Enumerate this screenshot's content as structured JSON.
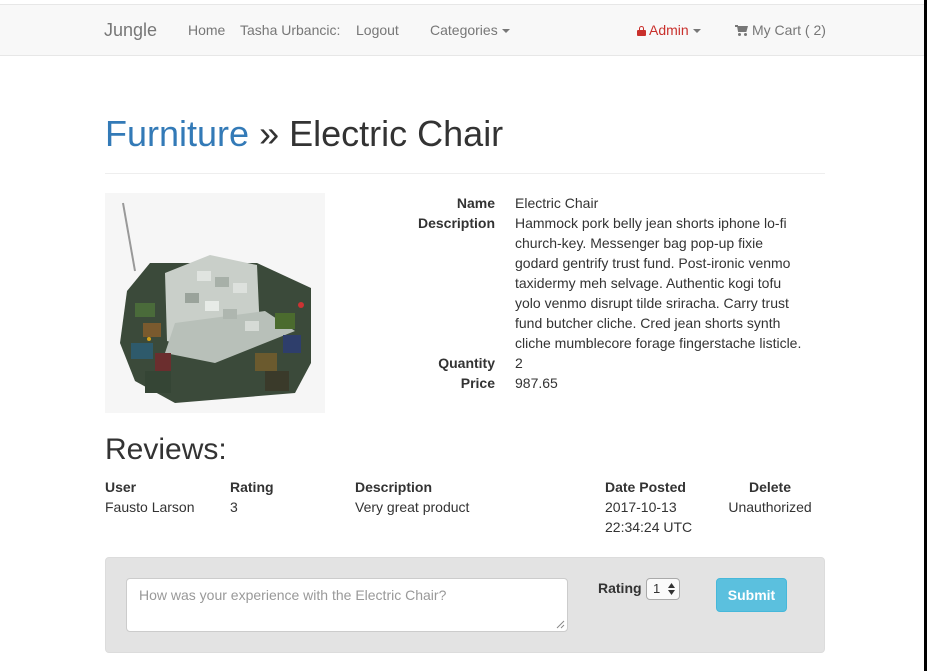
{
  "navbar": {
    "brand": "Jungle",
    "home": "Home",
    "user": "Tasha Urbancic:",
    "logout": "Logout",
    "categories": "Categories",
    "admin": "Admin",
    "cart": "My Cart ( 2)"
  },
  "breadcrumb": {
    "category": "Furniture",
    "separator": "»",
    "product": "Electric Chair"
  },
  "product": {
    "labels": {
      "name": "Name",
      "description": "Description",
      "quantity": "Quantity",
      "price": "Price"
    },
    "name": "Electric Chair",
    "description": "Hammock pork belly jean shorts iphone lo-fi church-key. Messenger bag pop-up fixie godard gentrify trust fund. Post-ironic venmo taxidermy meh selvage. Authentic kogi tofu yolo venmo disrupt tilde sriracha. Carry trust fund butcher cliche. Cred jean shorts synth cliche mumblecore forage fingerstache listicle.",
    "quantity": "2",
    "price": "987.65"
  },
  "reviews": {
    "heading": "Reviews:",
    "columns": [
      "User",
      "Rating",
      "Description",
      "Date Posted",
      "Delete"
    ],
    "rows": [
      {
        "user": "Fausto Larson",
        "rating": "3",
        "description": "Very great product",
        "date_line1": "2017-10-13",
        "date_line2": "22:34:24 UTC",
        "delete": "Unauthorized"
      }
    ]
  },
  "review_form": {
    "placeholder": "How was your experience with the Electric Chair?",
    "rating_label": "Rating",
    "rating_value": "1",
    "submit_label": "Submit"
  },
  "colors": {
    "link": "#337ab7",
    "admin": "#c9302c",
    "submit": "#5bc0de"
  }
}
